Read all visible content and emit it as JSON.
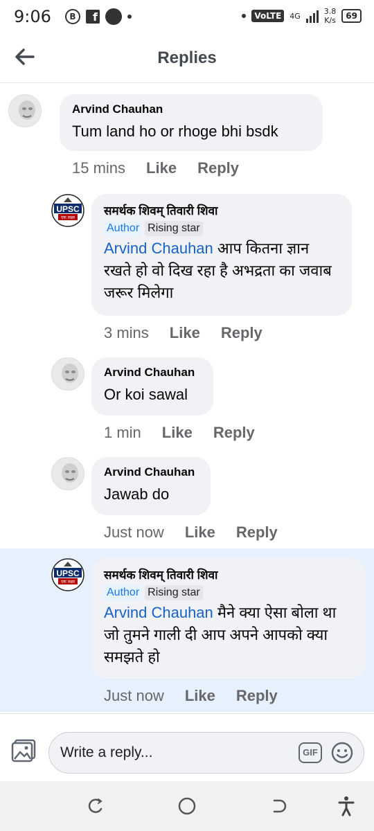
{
  "status_bar": {
    "time": "9:06",
    "network": "VoLTE",
    "network_type": "4G",
    "speed_value": "3.8",
    "speed_unit": "K/s",
    "battery": "69"
  },
  "header": {
    "title": "Replies",
    "back_icon": "arrow-left-icon"
  },
  "comments": [
    {
      "author": "Arvind Chauhan",
      "text": "Tum land ho or rhoge bhi bsdk",
      "time": "15 mins",
      "like": "Like",
      "reply": "Reply"
    },
    {
      "author": "समर्थक शिवम् तिवारी शिवा",
      "badges": [
        "Author",
        "Rising star"
      ],
      "mention": "Arvind Chauhan",
      "text": " आप कितना ज्ञान रखते हो वो दिख रहा  है अभद्रता का जवाब जरूर मिलेगा",
      "time": "3 mins",
      "like": "Like",
      "reply": "Reply"
    },
    {
      "author": "Arvind Chauhan",
      "text": "Or koi sawal",
      "time": "1 min",
      "like": "Like",
      "reply": "Reply"
    },
    {
      "author": "Arvind Chauhan",
      "text": "Jawab do",
      "time": "Just now",
      "like": "Like",
      "reply": "Reply"
    },
    {
      "author": "समर्थक शिवम् तिवारी शिवा",
      "badges": [
        "Author",
        "Rising star"
      ],
      "mention": "Arvind Chauhan",
      "text": "  मैने क्या ऐसा बोला था जो तुमने गाली दी आप अपने आपको क्या समझते हो",
      "time": "Just now",
      "like": "Like",
      "reply": "Reply"
    }
  ],
  "upsc_logo": {
    "label_top": "UPSC",
    "label_bottom": "एक लक्ष्य"
  },
  "composer": {
    "placeholder": "Write a reply...",
    "gif_label": "GIF"
  },
  "colors": {
    "mention": "#1762c7",
    "highlight": "#e7f0fd",
    "bubble": "#f0f2f5"
  }
}
